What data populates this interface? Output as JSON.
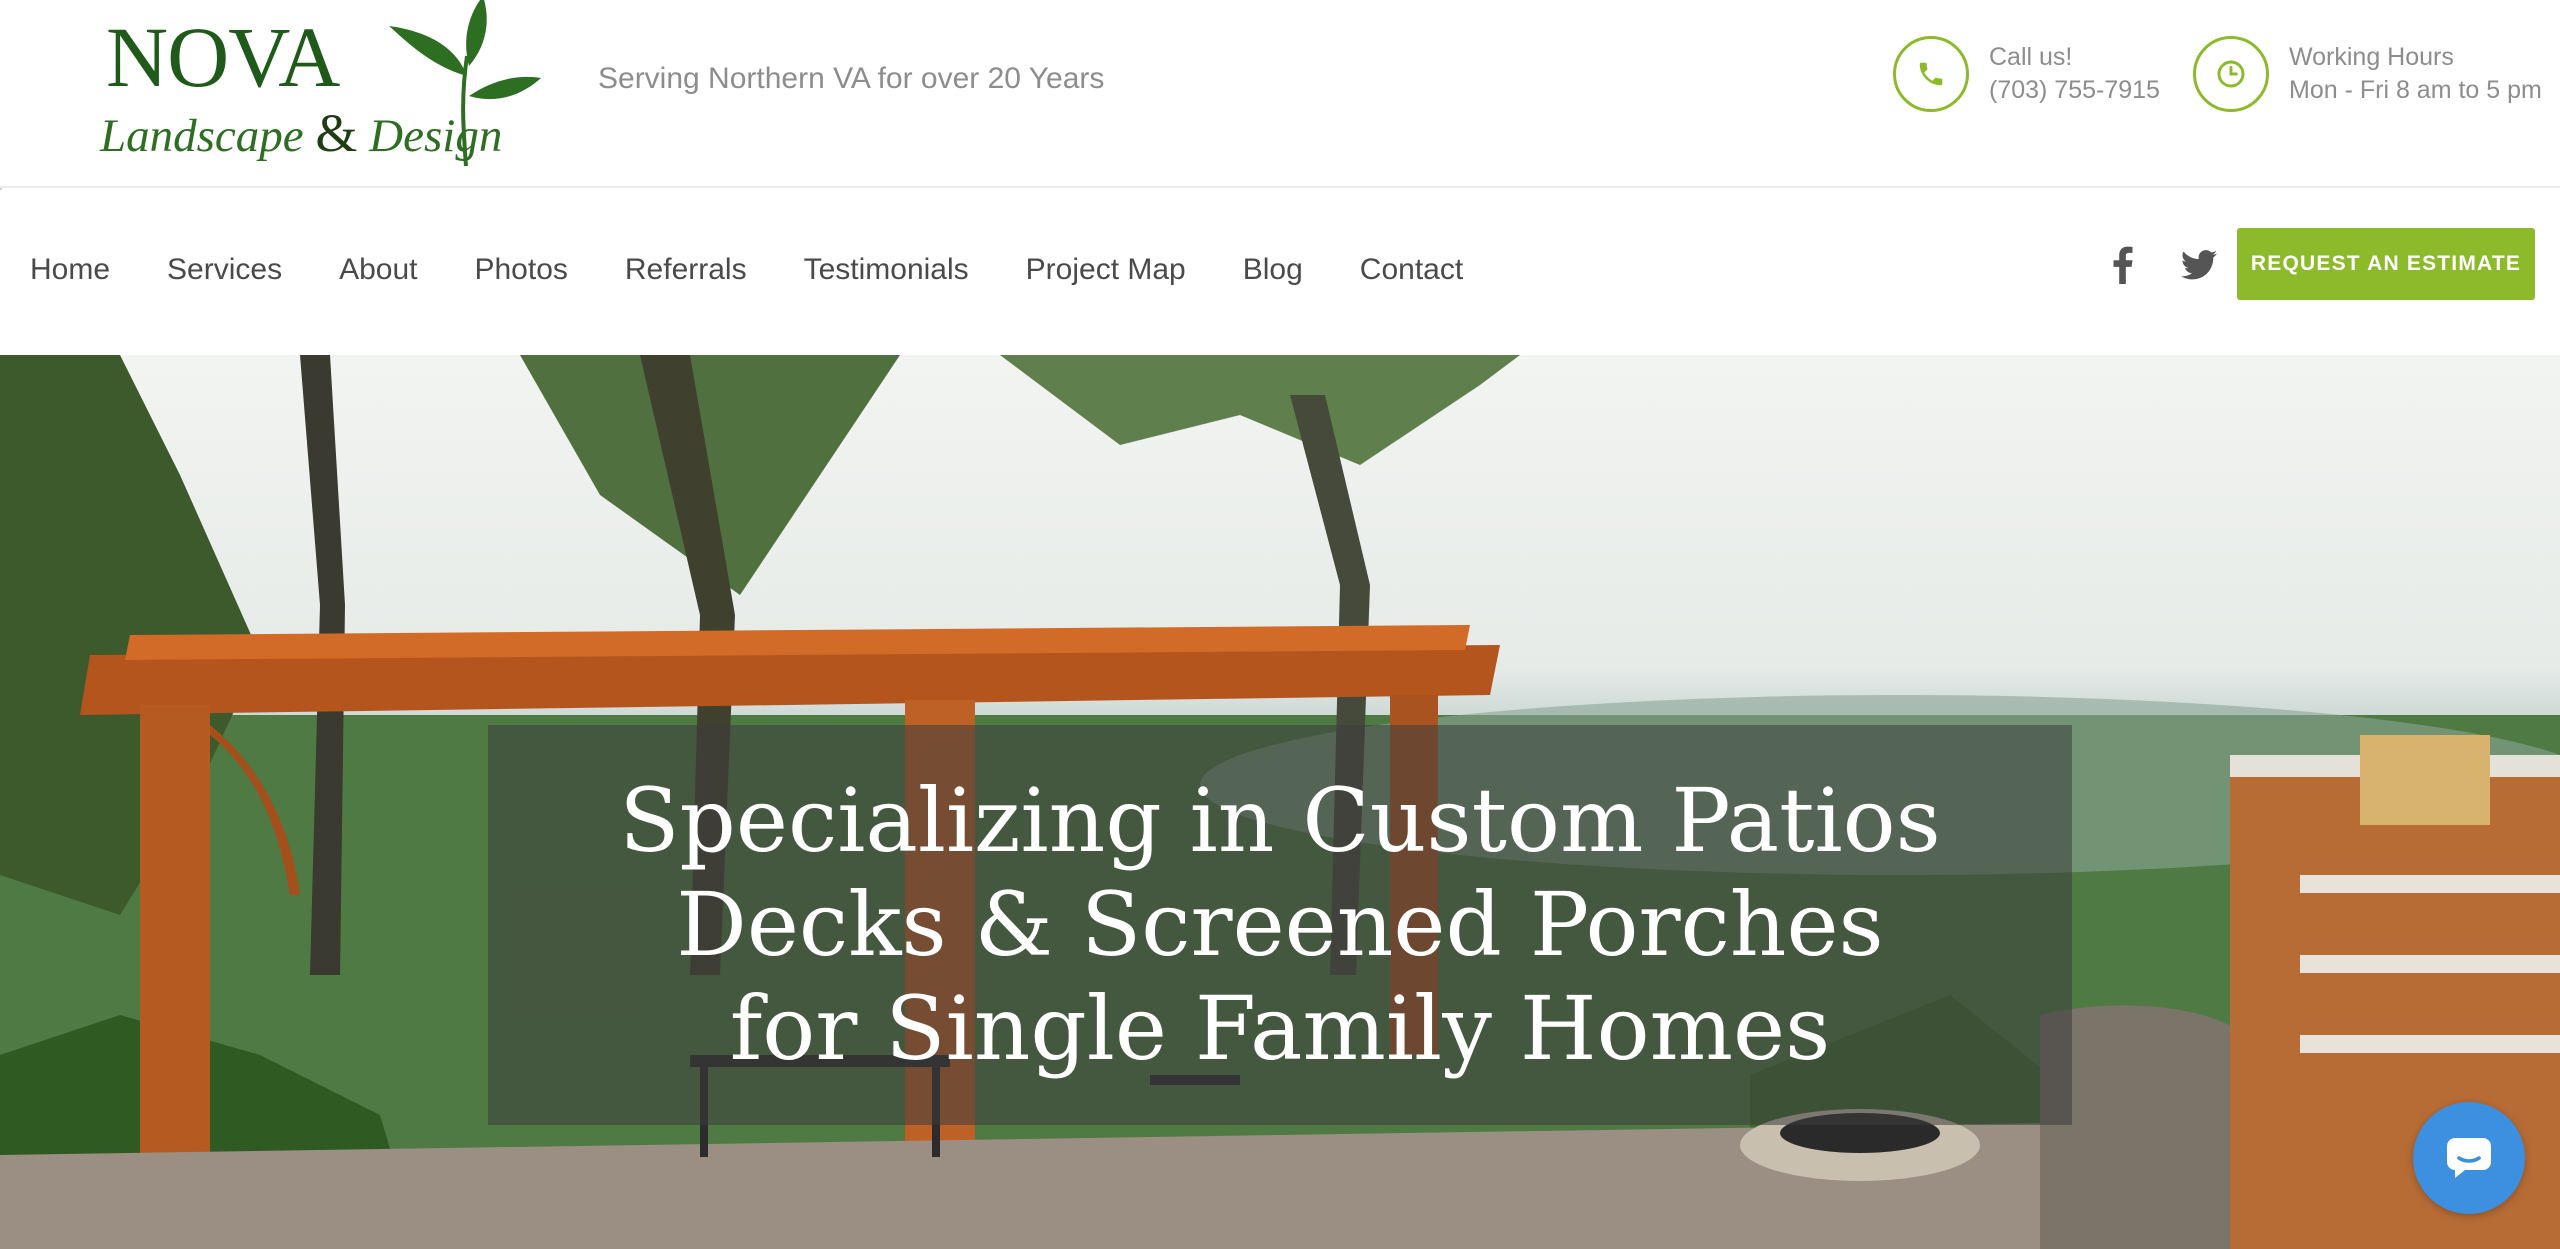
{
  "brand": {
    "logo_main": "NOVA",
    "logo_sub_part1": "Landscape ",
    "logo_amp": "&",
    "logo_sub_part2": " Design",
    "tagline": "Serving Northern VA for over 20 Years"
  },
  "contact": {
    "call_label": "Call us!",
    "phone": "(703) 755-7915",
    "hours_label": "Working Hours",
    "hours_value": "Mon - Fri 8 am to 5 pm"
  },
  "nav": {
    "items": [
      {
        "label": "Home"
      },
      {
        "label": "Services"
      },
      {
        "label": "About"
      },
      {
        "label": "Photos"
      },
      {
        "label": "Referrals"
      },
      {
        "label": "Testimonials"
      },
      {
        "label": "Project Map"
      },
      {
        "label": "Blog"
      },
      {
        "label": "Contact"
      }
    ],
    "social": [
      "facebook-icon",
      "twitter-icon"
    ],
    "cta_label": "REQUEST AN ESTIMATE"
  },
  "hero": {
    "lines": [
      "Specializing in Custom Patios",
      "Decks & Screened Porches",
      "for Single Family Homes"
    ]
  },
  "chat": {
    "icon": "chat-bubble-icon"
  },
  "colors": {
    "accent": "#8cba2b",
    "logo_green": "#1f5a1a",
    "text_gray": "#8d8d8d",
    "nav_text": "#4a4a4a",
    "chat_blue": "#3d8fe0"
  }
}
